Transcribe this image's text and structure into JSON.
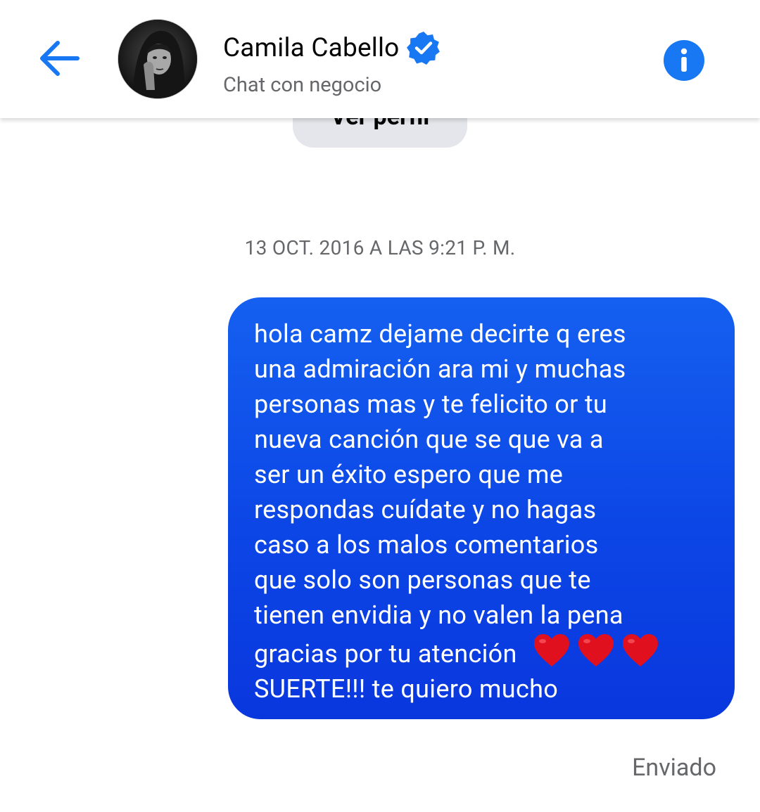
{
  "header": {
    "contact_name": "Camila Cabello",
    "subtitle": "Chat con negocio",
    "back_icon": "arrow-left-icon",
    "verified_icon": "verified-badge-icon",
    "info_icon": "info-icon"
  },
  "profile_button": {
    "label": "Ver perfil"
  },
  "conversation": {
    "timestamp": "13 OCT. 2016 A LAS 9:21 P. M.",
    "message": {
      "lines": [
        "hola camz dejame decirte q eres",
        "una admiración ara mi y muchas",
        "personas mas y te felicito or tu",
        "nueva canción que se que va a",
        "ser un éxito espero que me",
        "respondas cuídate y no hagas",
        "caso a los malos comentarios",
        "que solo son personas que te",
        "tienen envidia y no valen la pena",
        "gracias por tu atención",
        "SUERTE!!! te quiero mucho"
      ],
      "emoji": [
        "❤️",
        "❤️",
        "❤️"
      ]
    },
    "status": "Enviado"
  },
  "colors": {
    "accent": "#1877f2",
    "bubble_top": "#1560f0",
    "bubble_bottom": "#0937de",
    "heart": "#e0101e"
  }
}
